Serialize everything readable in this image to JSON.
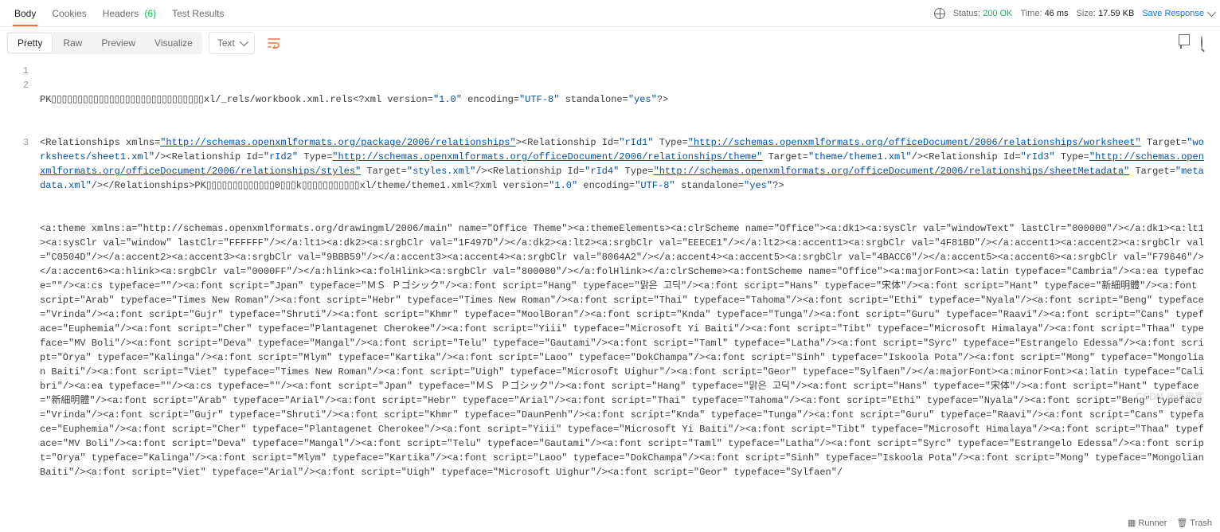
{
  "tabs": {
    "body": "Body",
    "cookies": "Cookies",
    "headers": "Headers",
    "headers_count": "(6)",
    "test_results": "Test Results"
  },
  "status_bar": {
    "status_label": "Status:",
    "status_value": "200 OK",
    "time_label": "Time:",
    "time_value": "46 ms",
    "size_label": "Size:",
    "size_value": "17.59 KB",
    "save": "Save Response"
  },
  "view_controls": {
    "pretty": "Pretty",
    "raw": "Raw",
    "preview": "Preview",
    "visualize": "Visualize",
    "format_label": "Text"
  },
  "code": {
    "ln1": "1",
    "ln2": "2",
    "ln3": "3",
    "line1_a": "PK▯▯▯▯▯▯▯▯▯▯▯▯▯▯▯▯▯▯▯▯▯▯▯▯▯▯▯▯▯xl/_rels/workbook.xml.rels<?xml version=",
    "line1_b": "\"1.0\"",
    "line1_c": " encoding=",
    "line1_d": "\"UTF-8\"",
    "line1_e": " standalone=",
    "line1_f": "\"yes\"",
    "line1_g": "?>",
    "l2a": "<Relationships xmlns=",
    "l2_url1": "\"http://schemas.openxmlformats.org/package/2006/relationships\"",
    "l2b": "><Relationship Id=",
    "l2_rid1": "\"rId1\"",
    "l2c": " Type=",
    "l2_url2": "\"http://schemas.openxmlformats.org/officeDocument/2006/relationships/worksheet\"",
    "l2d": " Target=",
    "l2_t1": "\"worksheets/sheet1.xml\"",
    "l2e": "/><Relationship Id=",
    "l2_rid2": "\"rId2\"",
    "l2f": " Type=",
    "l2_url3": "\"http://schemas.openxmlformats.org/officeDocument/2006/relationships/theme\"",
    "l2g": " Target=",
    "l2_t2": "\"theme/theme1.xml\"",
    "l2h": "/><Relationship Id=",
    "l2_rid3": "\"rId3\"",
    "l2i": " Type=",
    "l2_url4": "\"http://schemas.openxmlformats.org/officeDocument/2006/relationships/styles\"",
    "l2j": " Target=",
    "l2_t3": "\"styles.xml\"",
    "l2k": "/><Relationship Id=",
    "l2_rid4": "\"rId4\"",
    "l2l": " Type=",
    "l2_url5": "\"http://schemas.openxmlformats.org/officeDocument/2006/relationships/sheetMetadata\"",
    "l2m": " Target=",
    "l2_t4": "\"metadata.xml\"",
    "l2n": "/></Relationships>PK▯▯▯▯▯▯▯▯▯▯▯▯▯0▯▯▯k▯▯▯▯▯▯▯▯▯▯▯xl/theme/theme1.xml<?xml version=",
    "l2o": "\"1.0\"",
    "l2p": " encoding=",
    "l2q": "\"UTF-8\"",
    "l2r": " standalone=",
    "l2s": "\"yes\"",
    "l2t": "?>",
    "l3": "<a:theme xmlns:a=\"http://schemas.openxmlformats.org/drawingml/2006/main\" name=\"Office Theme\"><a:themeElements><a:clrScheme name=\"Office\"><a:dk1><a:sysClr val=\"windowText\" lastClr=\"000000\"/></a:dk1><a:lt1><a:sysClr val=\"window\" lastClr=\"FFFFFF\"/></a:lt1><a:dk2><a:srgbClr val=\"1F497D\"/></a:dk2><a:lt2><a:srgbClr val=\"EEECE1\"/></a:lt2><a:accent1><a:srgbClr val=\"4F81BD\"/></a:accent1><a:accent2><a:srgbClr val=\"C0504D\"/></a:accent2><a:accent3><a:srgbClr val=\"9BBB59\"/></a:accent3><a:accent4><a:srgbClr val=\"8064A2\"/></a:accent4><a:accent5><a:srgbClr val=\"4BACC6\"/></a:accent5><a:accent6><a:srgbClr val=\"F79646\"/></a:accent6><a:hlink><a:srgbClr val=\"0000FF\"/></a:hlink><a:folHlink><a:srgbClr val=\"800080\"/></a:folHlink></a:clrScheme><a:fontScheme name=\"Office\"><a:majorFont><a:latin typeface=\"Cambria\"/><a:ea typeface=\"\"/><a:cs typeface=\"\"/><a:font script=\"Jpan\" typeface=\"ＭＳ Ｐゴシック\"/><a:font script=\"Hang\" typeface=\"맑은 고딕\"/><a:font script=\"Hans\" typeface=\"宋体\"/><a:font script=\"Hant\" typeface=\"新細明體\"/><a:font script=\"Arab\" typeface=\"Times New Roman\"/><a:font script=\"Hebr\" typeface=\"Times New Roman\"/><a:font script=\"Thai\" typeface=\"Tahoma\"/><a:font script=\"Ethi\" typeface=\"Nyala\"/><a:font script=\"Beng\" typeface=\"Vrinda\"/><a:font script=\"Gujr\" typeface=\"Shruti\"/><a:font script=\"Khmr\" typeface=\"MoolBoran\"/><a:font script=\"Knda\" typeface=\"Tunga\"/><a:font script=\"Guru\" typeface=\"Raavi\"/><a:font script=\"Cans\" typeface=\"Euphemia\"/><a:font script=\"Cher\" typeface=\"Plantagenet Cherokee\"/><a:font script=\"Yiii\" typeface=\"Microsoft Yi Baiti\"/><a:font script=\"Tibt\" typeface=\"Microsoft Himalaya\"/><a:font script=\"Thaa\" typeface=\"MV Boli\"/><a:font script=\"Deva\" typeface=\"Mangal\"/><a:font script=\"Telu\" typeface=\"Gautami\"/><a:font script=\"Taml\" typeface=\"Latha\"/><a:font script=\"Syrc\" typeface=\"Estrangelo Edessa\"/><a:font script=\"Orya\" typeface=\"Kalinga\"/><a:font script=\"Mlym\" typeface=\"Kartika\"/><a:font script=\"Laoo\" typeface=\"DokChampa\"/><a:font script=\"Sinh\" typeface=\"Iskoola Pota\"/><a:font script=\"Mong\" typeface=\"Mongolian Baiti\"/><a:font script=\"Viet\" typeface=\"Times New Roman\"/><a:font script=\"Uigh\" typeface=\"Microsoft Uighur\"/><a:font script=\"Geor\" typeface=\"Sylfaen\"/></a:majorFont><a:minorFont><a:latin typeface=\"Calibri\"/><a:ea typeface=\"\"/><a:cs typeface=\"\"/><a:font script=\"Jpan\" typeface=\"ＭＳ Ｐゴシック\"/><a:font script=\"Hang\" typeface=\"맑은 고딕\"/><a:font script=\"Hans\" typeface=\"宋体\"/><a:font script=\"Hant\" typeface=\"新細明體\"/><a:font script=\"Arab\" typeface=\"Arial\"/><a:font script=\"Hebr\" typeface=\"Arial\"/><a:font script=\"Thai\" typeface=\"Tahoma\"/><a:font script=\"Ethi\" typeface=\"Nyala\"/><a:font script=\"Beng\" typeface=\"Vrinda\"/><a:font script=\"Gujr\" typeface=\"Shruti\"/><a:font script=\"Khmr\" typeface=\"DaunPenh\"/><a:font script=\"Knda\" typeface=\"Tunga\"/><a:font script=\"Guru\" typeface=\"Raavi\"/><a:font script=\"Cans\" typeface=\"Euphemia\"/><a:font script=\"Cher\" typeface=\"Plantagenet Cherokee\"/><a:font script=\"Yiii\" typeface=\"Microsoft Yi Baiti\"/><a:font script=\"Tibt\" typeface=\"Microsoft Himalaya\"/><a:font script=\"Thaa\" typeface=\"MV Boli\"/><a:font script=\"Deva\" typeface=\"Mangal\"/><a:font script=\"Telu\" typeface=\"Gautami\"/><a:font script=\"Taml\" typeface=\"Latha\"/><a:font script=\"Syrc\" typeface=\"Estrangelo Edessa\"/><a:font script=\"Orya\" typeface=\"Kalinga\"/><a:font script=\"Mlym\" typeface=\"Kartika\"/><a:font script=\"Laoo\" typeface=\"DokChampa\"/><a:font script=\"Sinh\" typeface=\"Iskoola Pota\"/><a:font script=\"Mong\" typeface=\"Mongolian Baiti\"/><a:font script=\"Viet\" typeface=\"Arial\"/><a:font script=\"Uigh\" typeface=\"Microsoft Uighur\"/><a:font script=\"Geor\" typeface=\"Sylfaen\"/"
  },
  "footer": {
    "runner": "Runner",
    "trash": "Trash",
    "watermark": "CSDN @远来客"
  }
}
